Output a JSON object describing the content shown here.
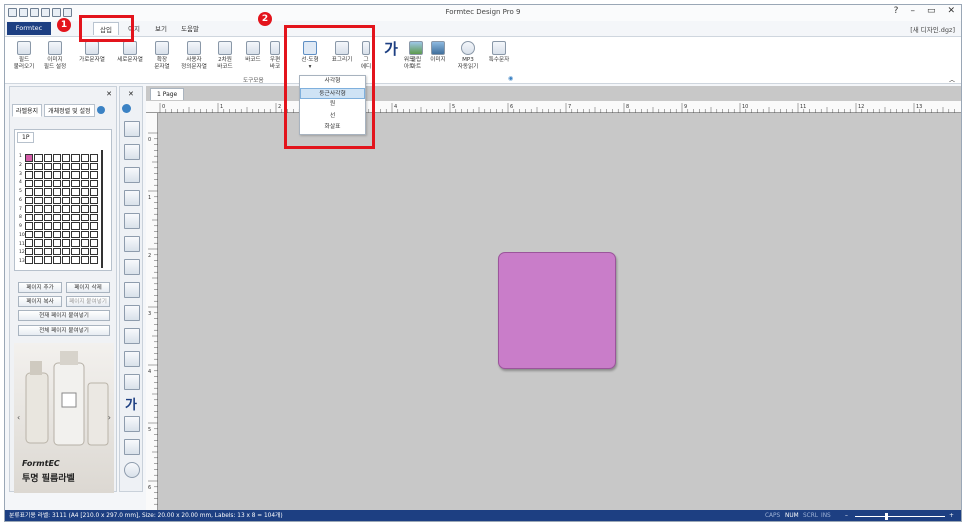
{
  "window": {
    "title": "Formtec Design Pro 9",
    "doc_name": "[새 디자인.dgz]",
    "controls": [
      "?",
      "–",
      "▭",
      "✕"
    ]
  },
  "menu": {
    "file": "Formtec",
    "tabs": [
      "삽입",
      "이지",
      "보기",
      "도움말"
    ],
    "active_tab": "삽입"
  },
  "ribbon": {
    "buttons": [
      {
        "label1": "필드",
        "label2": "불러오기"
      },
      {
        "label1": "이미지",
        "label2": "필드 설정"
      },
      {
        "label1": "가로문자열",
        "label2": ""
      },
      {
        "label1": "세로문자열",
        "label2": ""
      },
      {
        "label1": "확장",
        "label2": "문자열"
      },
      {
        "label1": "사용자",
        "label2": "정의문자열"
      },
      {
        "label1": "2차원",
        "label2": "바코드"
      },
      {
        "label1": "바코드",
        "label2": ""
      },
      {
        "label1": "우편",
        "label2": "바코"
      },
      {
        "label1": "선·도형",
        "label2": "▾"
      },
      {
        "label1": "표그리기",
        "label2": ""
      },
      {
        "label1": "그",
        "label2": "에디"
      },
      {
        "label1": "워드",
        "label2": "아트"
      },
      {
        "label1": "클립",
        "label2": "아트"
      },
      {
        "label1": "이미지",
        "label2": ""
      },
      {
        "label1": "MP3",
        "label2": "자동읽기"
      },
      {
        "label1": "특수문자",
        "label2": ""
      }
    ],
    "group_label": "도구모음",
    "big_glyph": "가"
  },
  "dropdown": {
    "items": [
      "사각형",
      "둥근사각형",
      "원",
      "선",
      "화살표"
    ],
    "highlighted": "둥근사각형"
  },
  "markers": {
    "one": "1",
    "two": "2"
  },
  "left_panel": {
    "tabs": [
      "라벨용지",
      "개체정렬 및 설정"
    ],
    "page_tab": "1P",
    "row_numbers": [
      "1",
      "2",
      "3",
      "4",
      "5",
      "6",
      "7",
      "8",
      "9",
      "10",
      "11",
      "12",
      "13"
    ],
    "buttons": {
      "add_page": "페이지 추가",
      "delete_page": "페이지 삭제",
      "copy_page": "페이지 복사",
      "paste_page": "페이지 붙여넣기",
      "paste_current": "현재 페이지 붙여넣기",
      "paste_all": "전체 페이지 붙여넣기"
    },
    "ad": {
      "brand": "FormtEC",
      "caption": "투명 필름라벨"
    }
  },
  "workspace": {
    "doc_tab": "1 Page",
    "ruler_marks": [
      "0",
      "1",
      "2",
      "3",
      "4",
      "5",
      "6",
      "7",
      "8",
      "9",
      "10",
      "11",
      "12",
      "13",
      "14",
      "15",
      "16",
      "17",
      "18",
      "19",
      "20"
    ],
    "shape_color": "#c97dc9"
  },
  "status": {
    "text": "분류표기용 라벨: 3111 (A4 [210.0 x 297.0 mm], Size: 20.00 x 20.00 mm, Labels: 13 x 8 = 104개)",
    "indicators": [
      "CAPS",
      "NUM",
      "SCRL",
      "INS"
    ]
  }
}
